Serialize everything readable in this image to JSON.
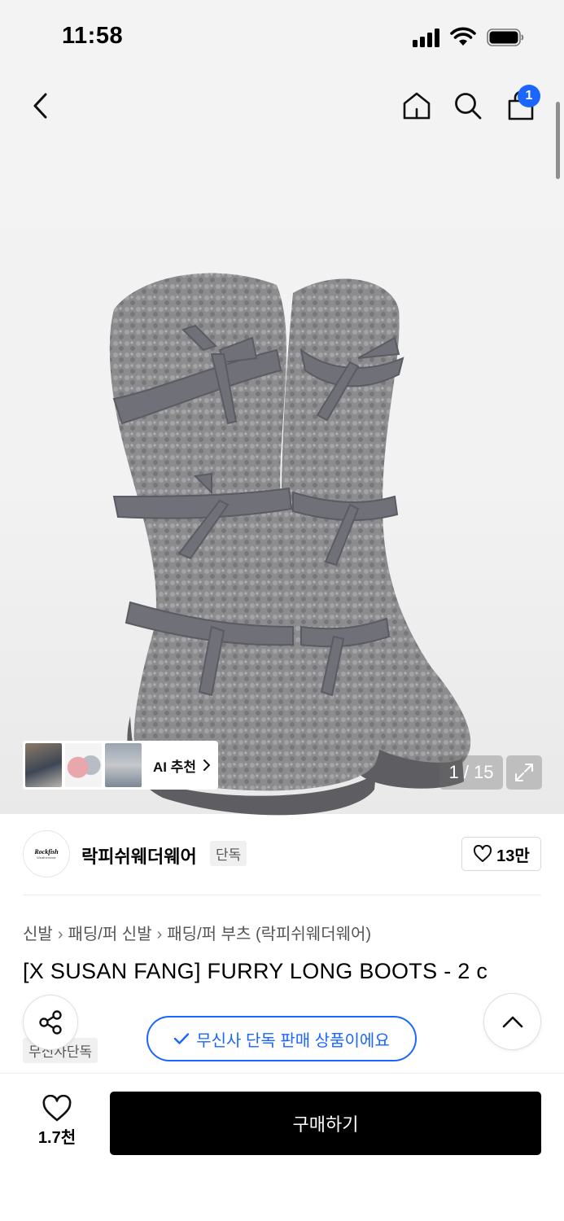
{
  "status": {
    "time": "11:58"
  },
  "nav": {
    "cart_count": "1"
  },
  "gallery": {
    "counter": "1 / 15",
    "ai_label": "AI 추천"
  },
  "brand": {
    "name": "락피쉬웨더웨어",
    "tag": "단독",
    "logo_text": "Rockfish",
    "logo_sub": "Weatherwear",
    "likes": "13만"
  },
  "breadcrumb": [
    "신발",
    "패딩/퍼 신발",
    "패딩/퍼 부츠 (락피쉬웨더웨어)"
  ],
  "product": {
    "title": "[X SUSAN FANG] FURRY LONG BOOTS - 2 c",
    "exclusive_tag": "무신사단독"
  },
  "notice": {
    "text": "무신사 단독 판매 상품이에요"
  },
  "bottom": {
    "wish_count": "1.7천",
    "buy_label": "구매하기"
  },
  "colors": {
    "accent": "#1a66ff",
    "buy": "#000000",
    "fur": "#8a8a8c",
    "ribbon": "#6f7078"
  }
}
